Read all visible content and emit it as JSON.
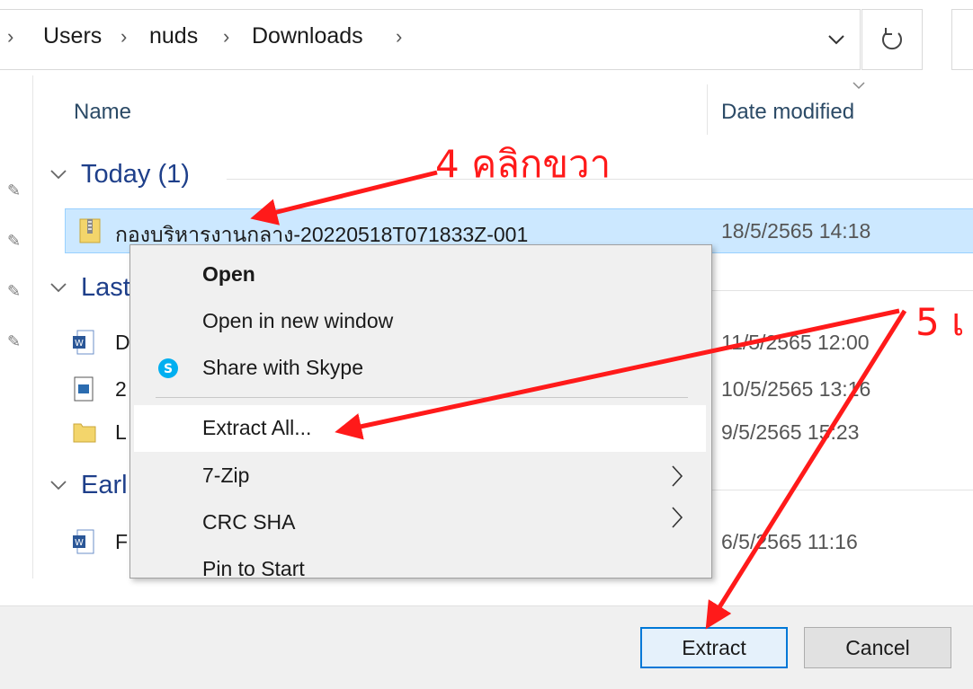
{
  "address": {
    "crumbs": [
      "Users",
      "nuds",
      "Downloads"
    ]
  },
  "columns": {
    "name": "Name",
    "date_modified": "Date modified"
  },
  "groups": {
    "today": {
      "label": "Today (1)"
    },
    "last": {
      "label": "Last"
    },
    "earlier": {
      "label": "Earl"
    }
  },
  "files": {
    "zip": {
      "name": "กองบริหารงานกลาง-20220518T071833Z-001",
      "date": "18/5/2565 14:18"
    },
    "doc1": {
      "name": "D",
      "date": "11/5/2565 12:00"
    },
    "img1": {
      "name": "2",
      "date": "10/5/2565 13:16"
    },
    "folder1": {
      "name": "L",
      "date": "9/5/2565 15:23"
    },
    "doc2": {
      "name": "F",
      "date": "6/5/2565 11:16"
    }
  },
  "context_menu": {
    "open": "Open",
    "open_new_window": "Open in new window",
    "share_skype": "Share with Skype",
    "extract_all": "Extract All...",
    "seven_zip": "7-Zip",
    "crc_sha": "CRC SHA",
    "pin_to_start": "Pin to Start"
  },
  "buttons": {
    "extract": "Extract",
    "cancel": "Cancel"
  },
  "annotations": {
    "step4": "4 คลิกขวา",
    "step5": "5 เ",
    "color": "#ff1a1a"
  },
  "colors": {
    "selection": "#cce8ff",
    "accent": "#0078d7"
  }
}
